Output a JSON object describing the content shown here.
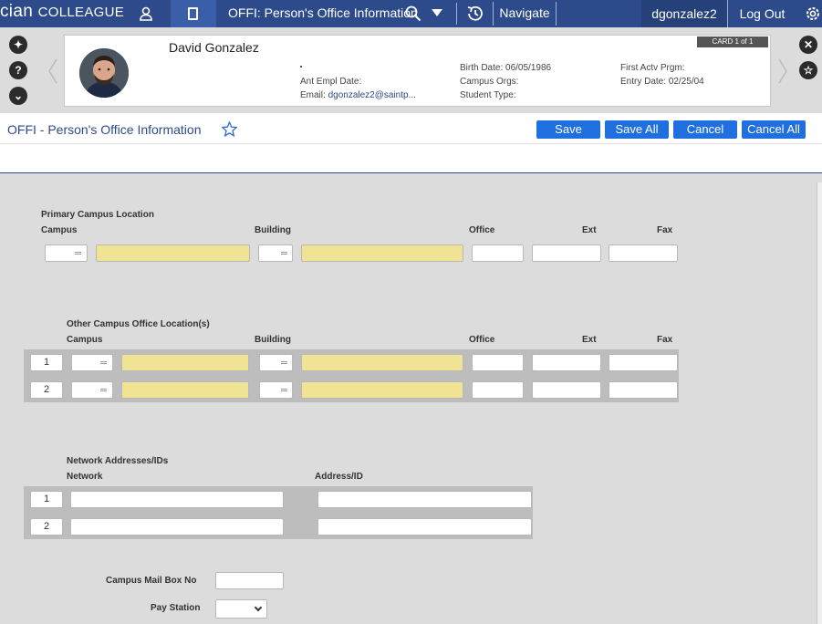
{
  "topbar": {
    "brand_prefix": "cian",
    "brand_name": "COLLEAGUE",
    "page_selector": "OFFI: Person's Office Information",
    "navigate_label": "Navigate",
    "username": "dgonzalez2",
    "logout_label": "Log Out"
  },
  "person_card": {
    "name": "David Gonzalez",
    "card_label": "CARD 1 of 1",
    "ant_empl_date_label": "Ant Empl Date:",
    "email_label": "Email:",
    "email_value": "dgonzalez2@saintp...",
    "birth_date_label": "Birth Date:",
    "birth_date_value": "06/05/1986",
    "campus_orgs_label": "Campus Orgs:",
    "student_type_label": "Student Type:",
    "first_actv_prgm_label": "First Actv Prgm:",
    "entry_date_label": "Entry Date:",
    "entry_date_value": "02/25/04"
  },
  "form": {
    "title": "OFFI - Person's Office Information",
    "buttons": {
      "save": "Save",
      "save_all": "Save All",
      "cancel": "Cancel",
      "cancel_all": "Cancel All"
    }
  },
  "primary": {
    "section_label": "Primary Campus Location",
    "campus_label": "Campus",
    "building_label": "Building",
    "office_label": "Office",
    "ext_label": "Ext",
    "fax_label": "Fax"
  },
  "other": {
    "section_label": "Other Campus Office Location(s)",
    "campus_label": "Campus",
    "building_label": "Building",
    "office_label": "Office",
    "ext_label": "Ext",
    "fax_label": "Fax",
    "rows": [
      "1",
      "2"
    ]
  },
  "network": {
    "section_label": "Network Addresses/IDs",
    "network_label": "Network",
    "address_label": "Address/ID",
    "rows": [
      "1",
      "2"
    ]
  },
  "mailbox_label": "Campus Mail Box No",
  "pay_station_label": "Pay Station",
  "colors": {
    "nav_bg": "#2d4a8a",
    "button_blue": "#1f6fe0",
    "required_field": "#f0e494",
    "form_bg": "#dcdcdc"
  }
}
